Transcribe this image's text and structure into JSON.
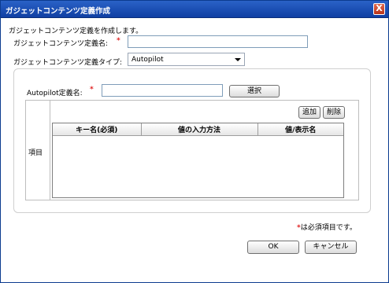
{
  "dialog": {
    "title": "ガジェットコンテンツ定義作成",
    "close_label": "X"
  },
  "form": {
    "description": "ガジェットコンテンツ定義を作成します。",
    "name_label": "ガジェットコンテンツ定義名:",
    "name_value": "",
    "type_label": "ガジェットコンテンツ定義タイプ:",
    "type_value": "Autopilot",
    "required_mark": "*"
  },
  "autopilot": {
    "name_label": "Autopilot定義名:",
    "name_value": "",
    "select_button": "選択"
  },
  "items": {
    "label": "項目",
    "add_button": "追加",
    "delete_button": "削除",
    "columns": [
      "キー名(必須)",
      "値の入力方法",
      "値/表示名"
    ],
    "rows": []
  },
  "footer": {
    "required_note_mark": "*",
    "required_note_text": "は必須項目です。",
    "ok_button": "OK",
    "cancel_button": "キャンセル"
  }
}
